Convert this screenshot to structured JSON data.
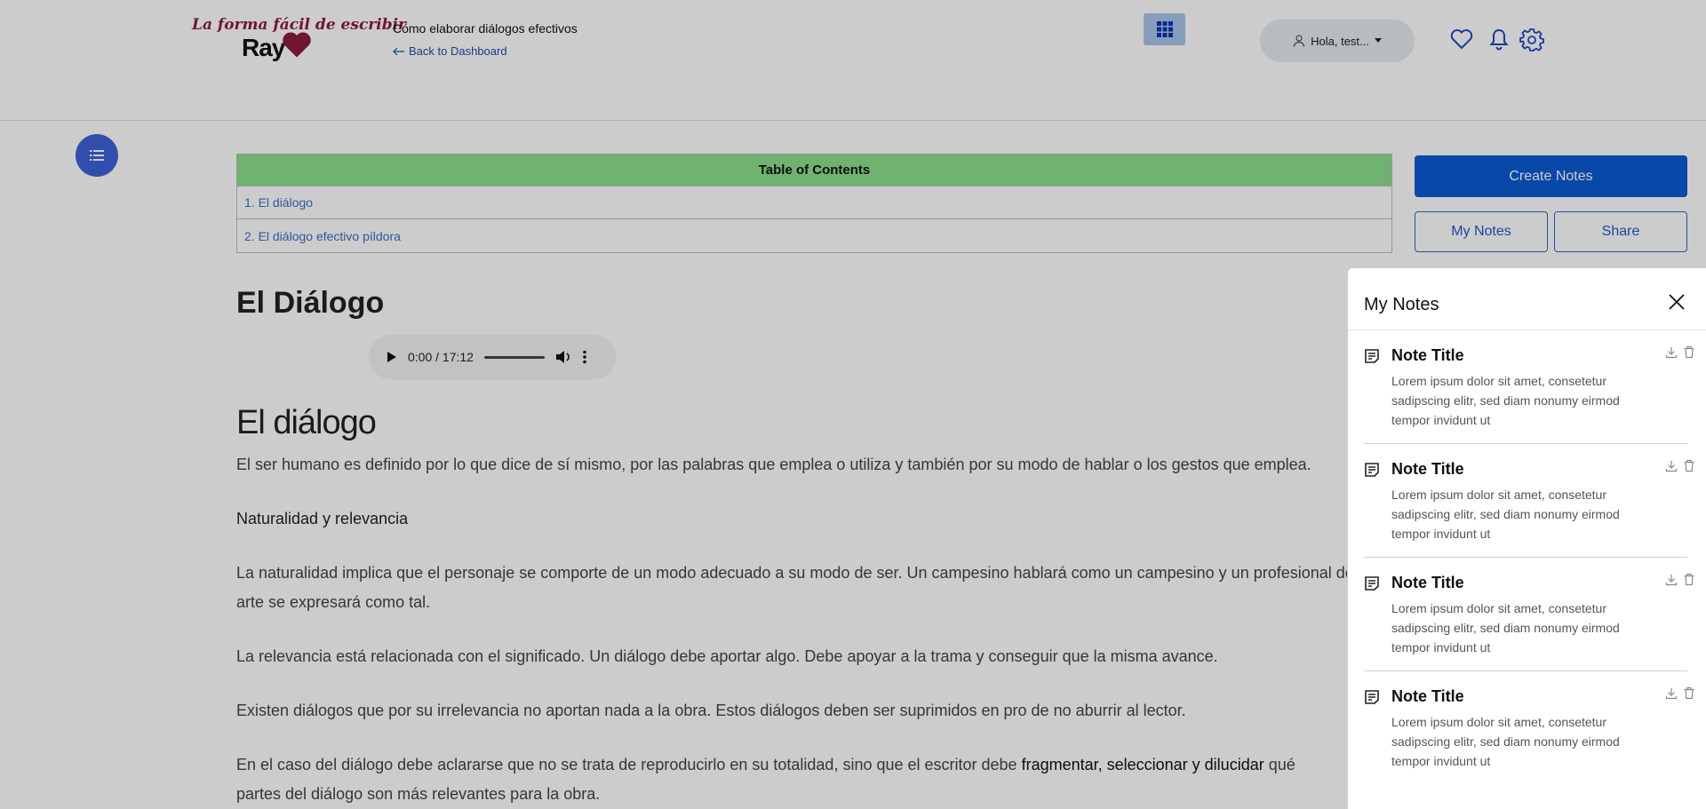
{
  "header": {
    "logo": {
      "tagline": "La forma fácil de escribir",
      "name": "Ray"
    },
    "course_title": "Cómo elaborar diálogos efectivos",
    "back_link": "Back to Dashboard",
    "user_menu": "Hola, test...",
    "icons": [
      "apps-grid-icon",
      "user-icon",
      "caret-down-icon",
      "heart-icon",
      "bell-icon",
      "gear-icon"
    ]
  },
  "toc": {
    "heading": "Table of Contents",
    "items": [
      "1. El diálogo",
      "2. El diálogo efectivo píldora"
    ]
  },
  "actions": {
    "create_notes": "Create Notes",
    "my_notes": "My Notes",
    "share": "Share"
  },
  "content": {
    "page_title": "El Diálogo",
    "audio_time": "0:00 / 17:12",
    "section_title": "El diálogo",
    "paragraphs": [
      "El ser humano es definido por lo que dice de sí mismo, por las palabras que emplea o utiliza y también por su modo de hablar o los gestos que emplea.",
      "Naturalidad y relevancia",
      "La naturalidad implica que el personaje se comporte de un modo adecuado a su modo de ser. Un campesino hablará como un campesino y un profesional del",
      "arte se expresará como tal.",
      "La relevancia está relacionada con el significado. Un diálogo debe aportar algo. Debe apoyar a la trama y conseguir que la misma avance.",
      "Existen diálogos que por su irrelevancia no aportan nada a la obra. Estos diálogos deben ser suprimidos en pro de no aburrir al lector."
    ],
    "last_paragraph": {
      "before": "En el caso del diálogo debe aclararse que no se trata de reproducirlo en su totalidad, sino que el escritor debe ",
      "emphasis": "fragmentar, seleccionar y dilucidar",
      "after": " qué",
      "line2": "partes del diálogo son más relevantes para la obra."
    }
  },
  "notes_panel": {
    "title": "My Notes",
    "notes": [
      {
        "title": "Note Title",
        "body": "Lorem ipsum dolor sit amet, consetetur sadipscing elitr, sed diam nonumy eirmod tempor invidunt ut"
      },
      {
        "title": "Note Title",
        "body": "Lorem ipsum dolor sit amet, consetetur sadipscing elitr, sed diam nonumy eirmod tempor invidunt ut"
      },
      {
        "title": "Note Title",
        "body": "Lorem ipsum dolor sit amet, consetetur sadipscing elitr, sed diam nonumy eirmod tempor invidunt ut"
      },
      {
        "title": "Note Title",
        "body": "Lorem ipsum dolor sit amet, consetetur sadipscing elitr, sed diam nonumy eirmod tempor invidunt ut"
      }
    ]
  },
  "colors": {
    "brand_blue": "#0a5ad2",
    "toc_header": "#8ddf8c",
    "link_blue": "#3a6fc6",
    "logo_red": "#8c1c3a"
  }
}
